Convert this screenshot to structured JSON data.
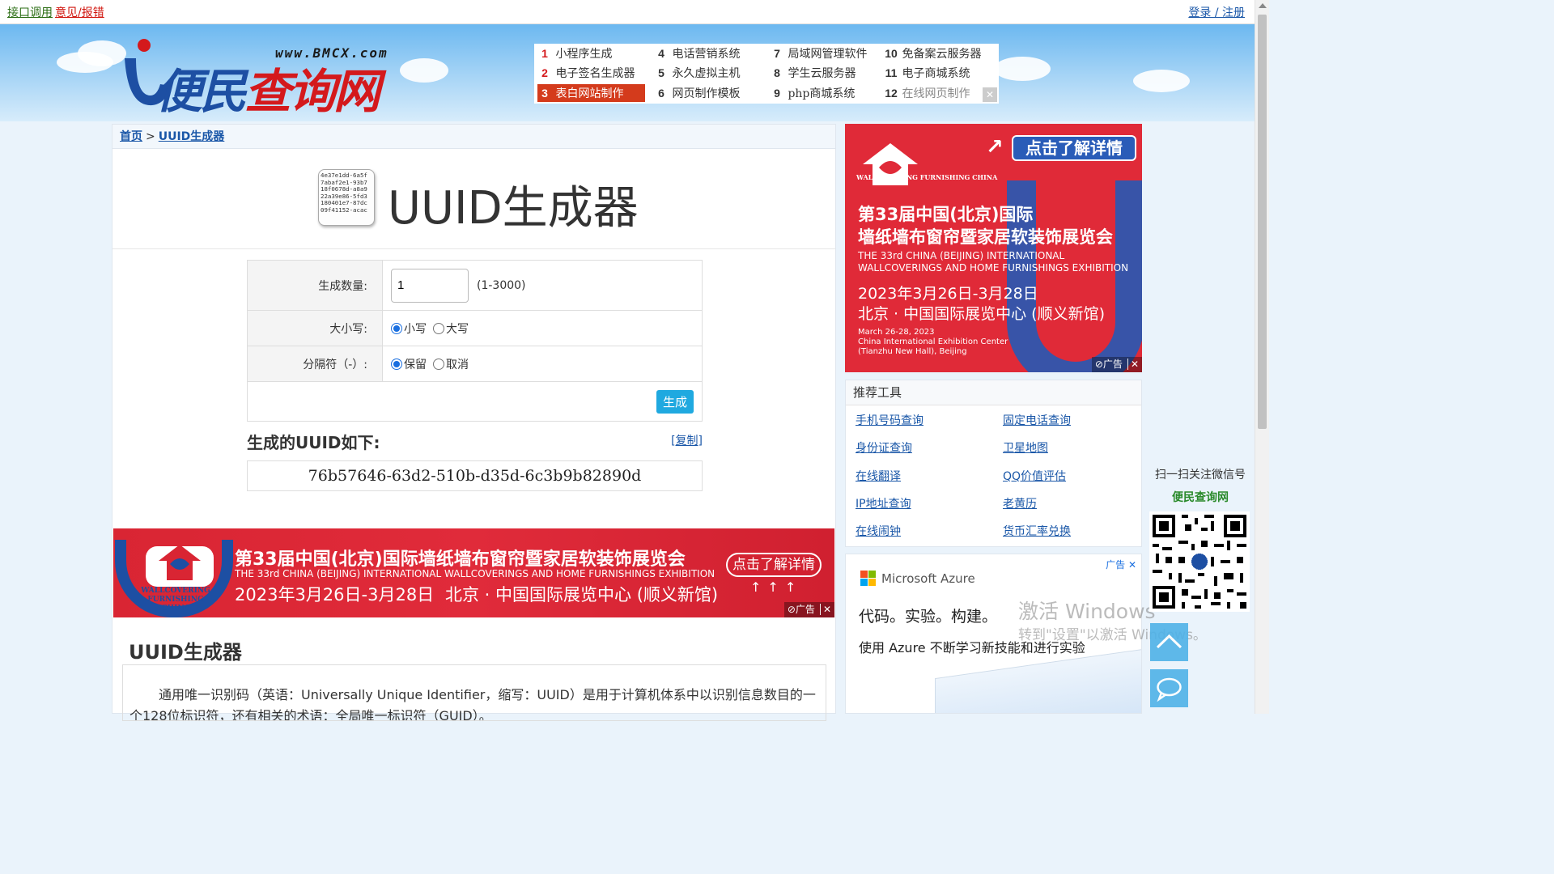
{
  "topbar": {
    "api_link": "接口调用",
    "feedback_link": "意见/报错",
    "login_link": "登录 / 注册"
  },
  "header": {
    "logo_text_blue": "便民",
    "logo_text_red": "查询网",
    "logo_url": "www.BMCX.com",
    "hot_links": [
      {
        "num": "1",
        "label": "小程序生成"
      },
      {
        "num": "2",
        "label": "电子签名生成器"
      },
      {
        "num": "3",
        "label": "表白网站制作"
      },
      {
        "num": "4",
        "label": "电话营销系统"
      },
      {
        "num": "5",
        "label": "永久虚拟主机"
      },
      {
        "num": "6",
        "label": "网页制作模板"
      },
      {
        "num": "7",
        "label": "局域网管理软件"
      },
      {
        "num": "8",
        "label": "学生云服务器"
      },
      {
        "num": "9",
        "label": "php商城系统"
      },
      {
        "num": "10",
        "label": "免备案云服务器"
      },
      {
        "num": "11",
        "label": "电子商城系统"
      },
      {
        "num": "12",
        "label": "在线网页制作"
      }
    ],
    "close_glyph": "✕"
  },
  "breadcrumb": {
    "home": "首页",
    "separator": ">",
    "current": "UUID生成器"
  },
  "icon_lines": [
    "4e37e1dd-6a5f",
    "7abaf2e1-93b7",
    "18f0678d-a8a9",
    "22a39e86-5fd3",
    "180401e7-87dc",
    "09f41152-acac"
  ],
  "page_title": "UUID生成器",
  "form": {
    "qty_label": "生成数量:",
    "qty_value": "1",
    "qty_range": "(1-3000)",
    "case_label": "大小写:",
    "case_lower": "小写",
    "case_upper": "大写",
    "case_selected": "小写",
    "sep_label": "分隔符（-）:",
    "sep_keep": "保留",
    "sep_remove": "取消",
    "sep_selected": "保留",
    "generate_button": "生成"
  },
  "result": {
    "heading": "生成的UUID如下:",
    "copy_link": "[复制]",
    "value": "76b57646-63d2-510b-d35d-6c3b9b82890d"
  },
  "ad_wide": {
    "org": "WALLCOVERING FURNISHING CHINA",
    "title": "第33届中国(北京)国际墙纸墙布窗帘暨家居软装饰展览会",
    "subtitle": "THE 33rd CHINA (BEIJING) INTERNATIONAL WALLCOVERINGS AND HOME FURNISHINGS EXHIBITION",
    "date": "2023年3月26日-3月28日",
    "venue": "北京 · 中国国际展览中心 (顺义新馆)",
    "cta": "点击了解详情",
    "arrows": "↑↑↑",
    "ad_label": "⊘广告",
    "close": "✕"
  },
  "desc": {
    "title": "UUID生成器",
    "text": "通用唯一识别码（英语：Universally Unique Identifier，缩写：UUID）是用于计算机体系中以识别信息数目的一个128位标识符，还有相关的术语：全局唯一标识符（GUID）。"
  },
  "ad_side": {
    "org": "WALLCOVERING FURNISHING CHINA",
    "cta": "点击了解详情",
    "arrow": "↗",
    "title_l1": "第33届中国(北京)国际",
    "title_l2": "墙纸墙布窗帘暨家居软装饰展览会",
    "en_l1": "THE 33rd CHINA (BEIJING) INTERNATIONAL",
    "en_l2": "WALLCOVERINGS AND HOME FURNISHINGS EXHIBITION",
    "date": "2023年3月26日-3月28日",
    "venue": "北京 · 中国国际展览中心 (顺义新馆)",
    "small_l1": "March 26-28, 2023",
    "small_l2": "China International Exhibition Center",
    "small_l3": "(Tianzhu New Hall), Beijing",
    "ad_label": "⊘广告",
    "close": "✕"
  },
  "tools": {
    "heading": "推荐工具",
    "items": [
      "手机号码查询",
      "固定电话查询",
      "身份证查询",
      "卫星地图",
      "在线翻译",
      "QQ价值评估",
      "IP地址查询",
      "老黄历",
      "在线闹钟",
      "货币汇率兑换"
    ]
  },
  "ms_ad": {
    "ad_label": "广告 ✕",
    "brand": "Microsoft Azure",
    "headline": "代码。实验。构建。",
    "sub": "使用 Azure 不断学习新技能和进行实验"
  },
  "watermark": {
    "line1": "激活 Windows",
    "line2": "转到\"设置\"以激活 Windows。"
  },
  "follow": {
    "text": "扫一扫关注微信号",
    "brand": "便民查询网"
  },
  "colors": {
    "link": "#1a57a8",
    "red": "#d4191c",
    "brand_blue": "#1d4fa3",
    "button": "#1fa9e0",
    "ad_red": "#e02a38"
  }
}
